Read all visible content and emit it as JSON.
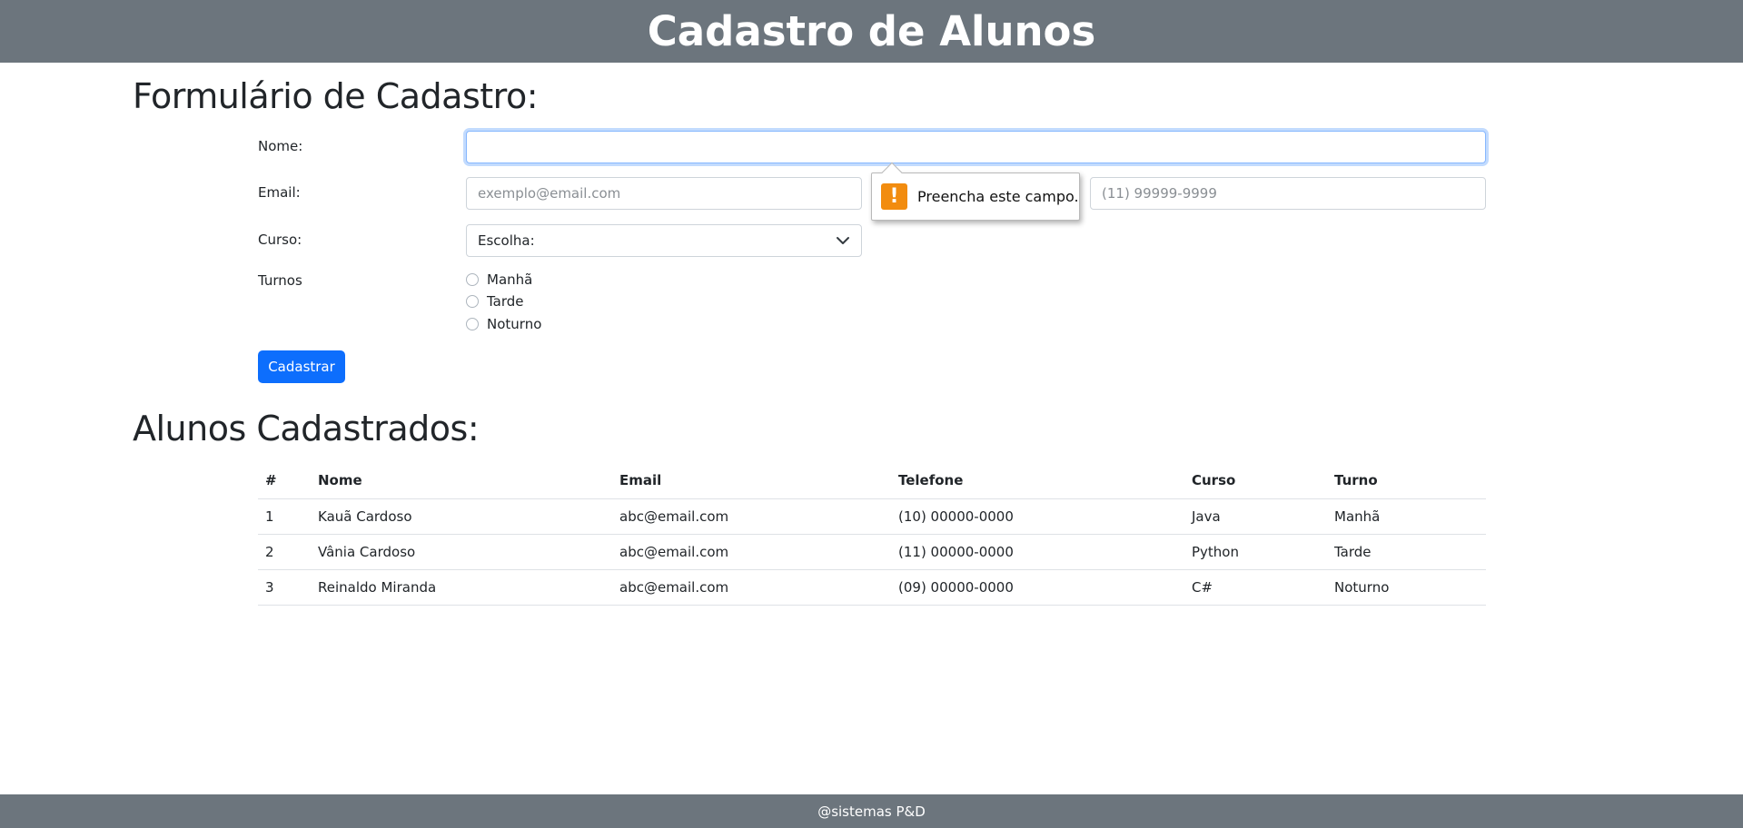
{
  "header": {
    "title": "Cadastro de Alunos"
  },
  "form": {
    "title": "Formulário de Cadastro:",
    "nome_label": "Nome:",
    "email_label": "Email:",
    "email_placeholder": "exemplo@email.com",
    "telefone_placeholder": "(11) 99999-9999",
    "curso_label": "Curso:",
    "curso_selected": "Escolha:",
    "turnos_label": "Turnos",
    "turnos": [
      "Manhã",
      "Tarde",
      "Noturno"
    ],
    "submit_label": "Cadastrar",
    "validation_message": "Preencha este campo.",
    "validation_icon": "!"
  },
  "list": {
    "title": "Alunos Cadastrados:",
    "columns": [
      "#",
      "Nome",
      "Email",
      "Telefone",
      "Curso",
      "Turno"
    ],
    "rows": [
      [
        "1",
        "Kauã Cardoso",
        "abc@email.com",
        "(10) 00000-0000",
        "Java",
        "Manhã"
      ],
      [
        "2",
        "Vânia Cardoso",
        "abc@email.com",
        "(11) 00000-0000",
        "Python",
        "Tarde"
      ],
      [
        "3",
        "Reinaldo Miranda",
        "abc@email.com",
        "(09) 00000-0000",
        "C#",
        "Noturno"
      ]
    ]
  },
  "footer": {
    "text": "@sistemas P&D"
  },
  "colors": {
    "header_bg": "#6c757d",
    "primary": "#0d6efd",
    "warning_icon": "#f28c0f"
  }
}
